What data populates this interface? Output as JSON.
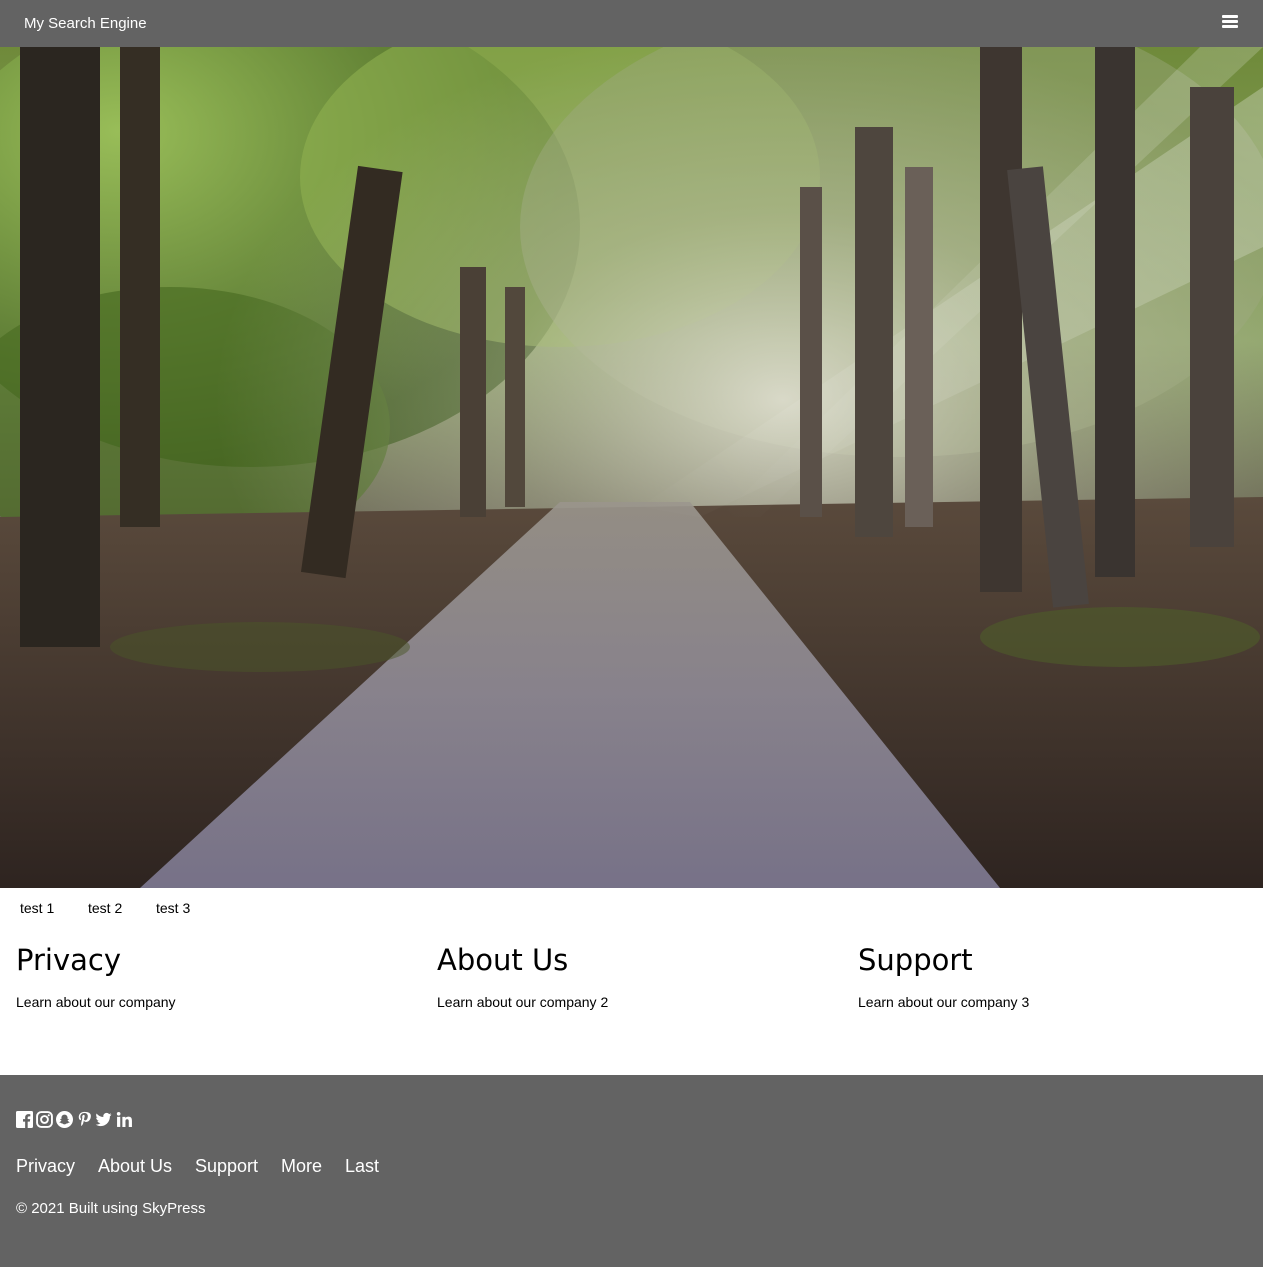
{
  "header": {
    "brand": "My Search Engine",
    "menu_icon": "hamburger-menu-icon",
    "bg_color": "#636363"
  },
  "hero": {
    "image": "forest-path-photo"
  },
  "subnav": {
    "items": [
      {
        "label": "test 1"
      },
      {
        "label": "test 2"
      },
      {
        "label": "test 3"
      }
    ]
  },
  "columns": [
    {
      "title": "Privacy",
      "text": "Learn about our company"
    },
    {
      "title": "About Us",
      "text": "Learn about our company 2"
    },
    {
      "title": "Support",
      "text": "Learn about our company 3"
    }
  ],
  "footer": {
    "social_icons": [
      "facebook-icon",
      "instagram-icon",
      "snapchat-icon",
      "pinterest-icon",
      "twitter-icon",
      "linkedin-icon"
    ],
    "links": [
      {
        "label": "Privacy"
      },
      {
        "label": "About Us"
      },
      {
        "label": "Support"
      },
      {
        "label": "More"
      },
      {
        "label": "Last"
      }
    ],
    "copyright": "© 2021 Built using SkyPress",
    "bg_color": "#636363"
  }
}
